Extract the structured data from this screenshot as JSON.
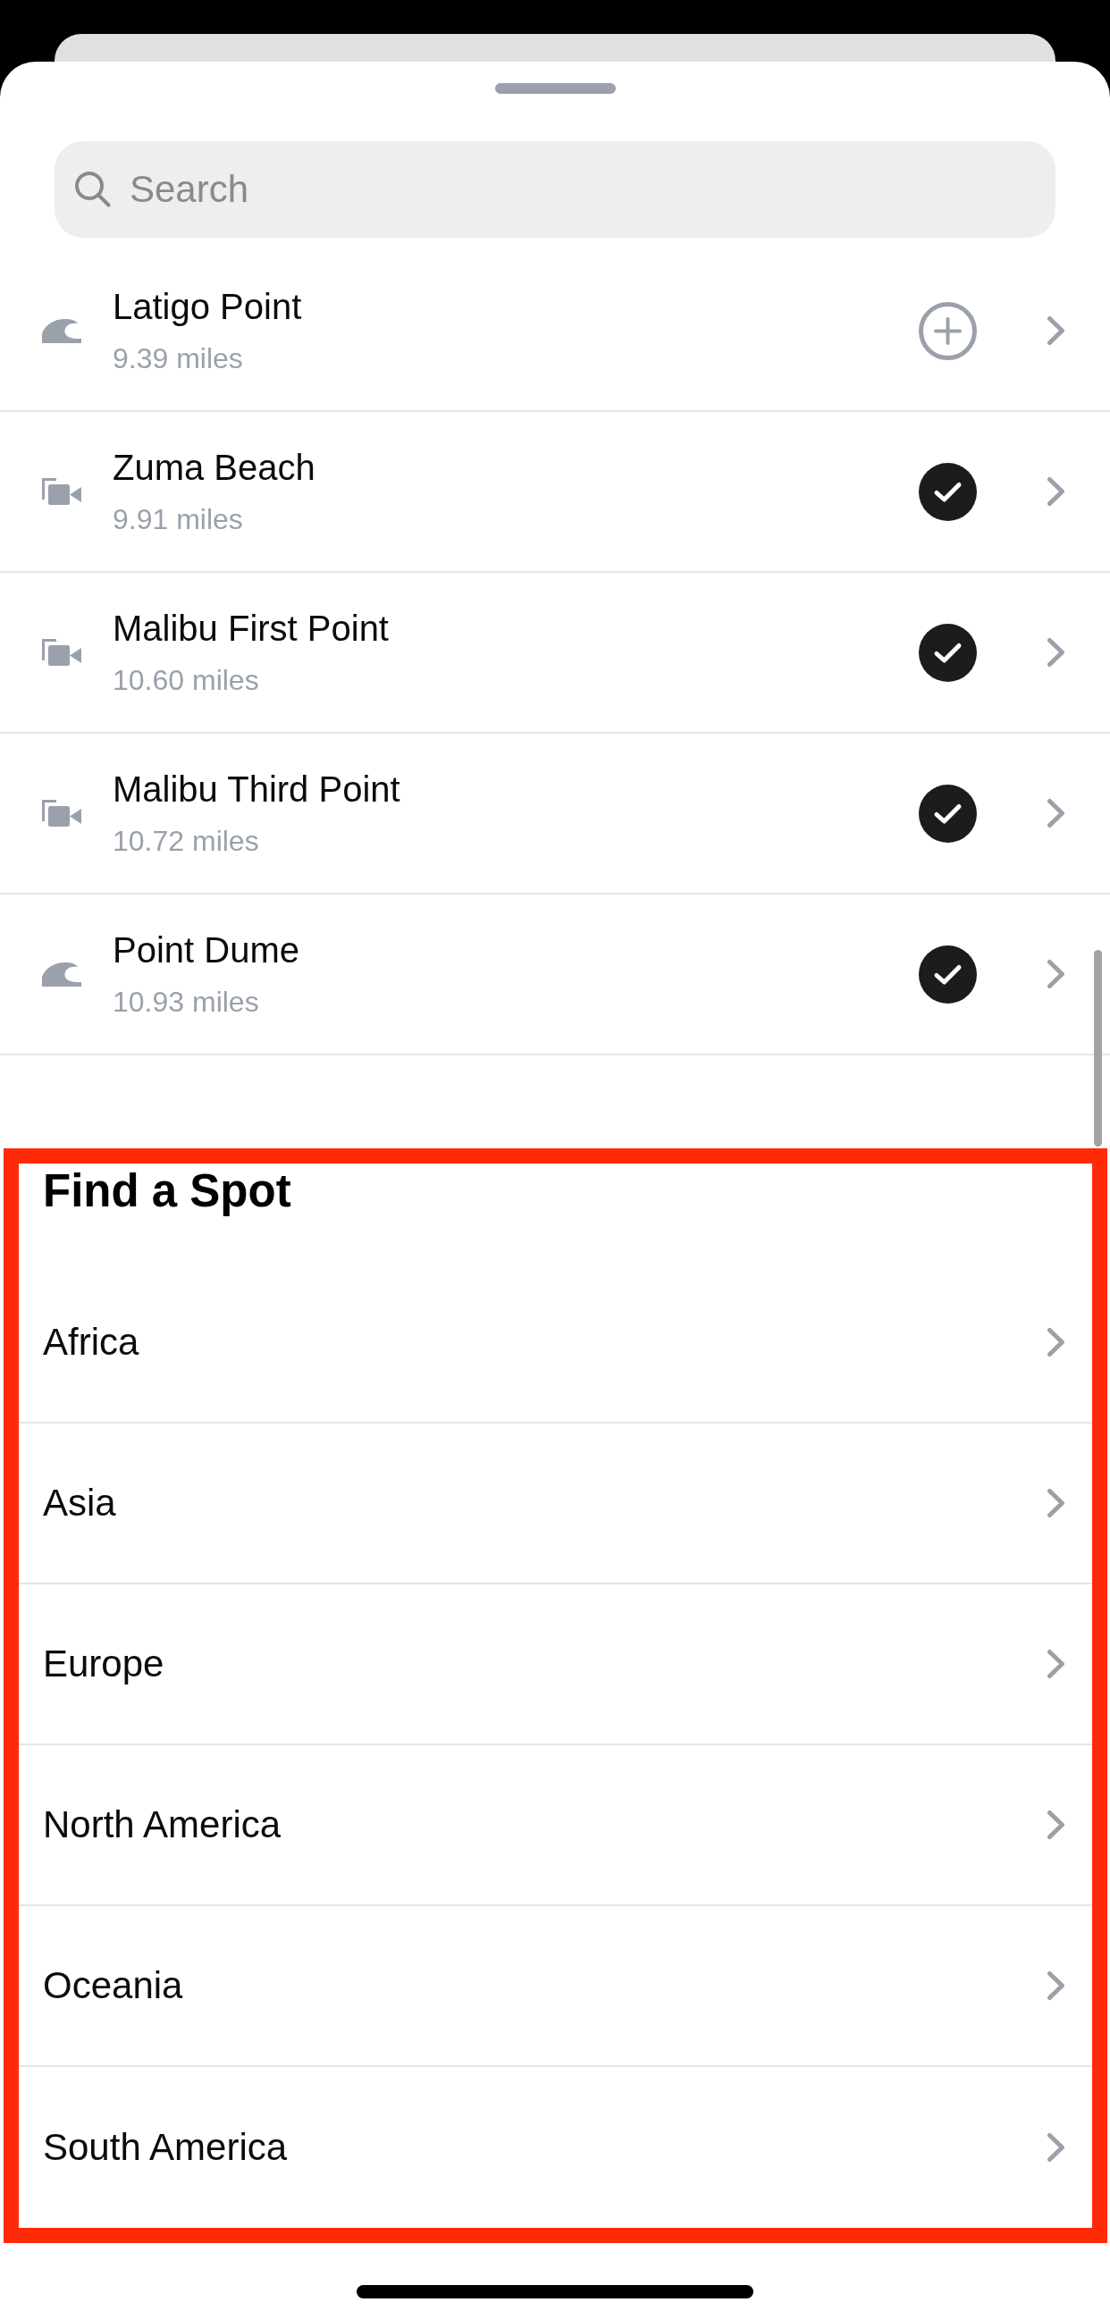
{
  "search": {
    "placeholder": "Search"
  },
  "spots": [
    {
      "kind": "wave",
      "name": "Latigo Point",
      "distance": "9.39 miles",
      "added": false
    },
    {
      "kind": "camera",
      "name": "Zuma Beach",
      "distance": "9.91 miles",
      "added": true
    },
    {
      "kind": "camera",
      "name": "Malibu First Point",
      "distance": "10.60 miles",
      "added": true
    },
    {
      "kind": "camera",
      "name": "Malibu Third Point",
      "distance": "10.72 miles",
      "added": true
    },
    {
      "kind": "wave",
      "name": "Point Dume",
      "distance": "10.93 miles",
      "added": true
    }
  ],
  "find_a_spot": {
    "title": "Find a Spot",
    "highlighted": true,
    "regions": [
      "Africa",
      "Asia",
      "Europe",
      "North America",
      "Oceania",
      "South America"
    ]
  }
}
